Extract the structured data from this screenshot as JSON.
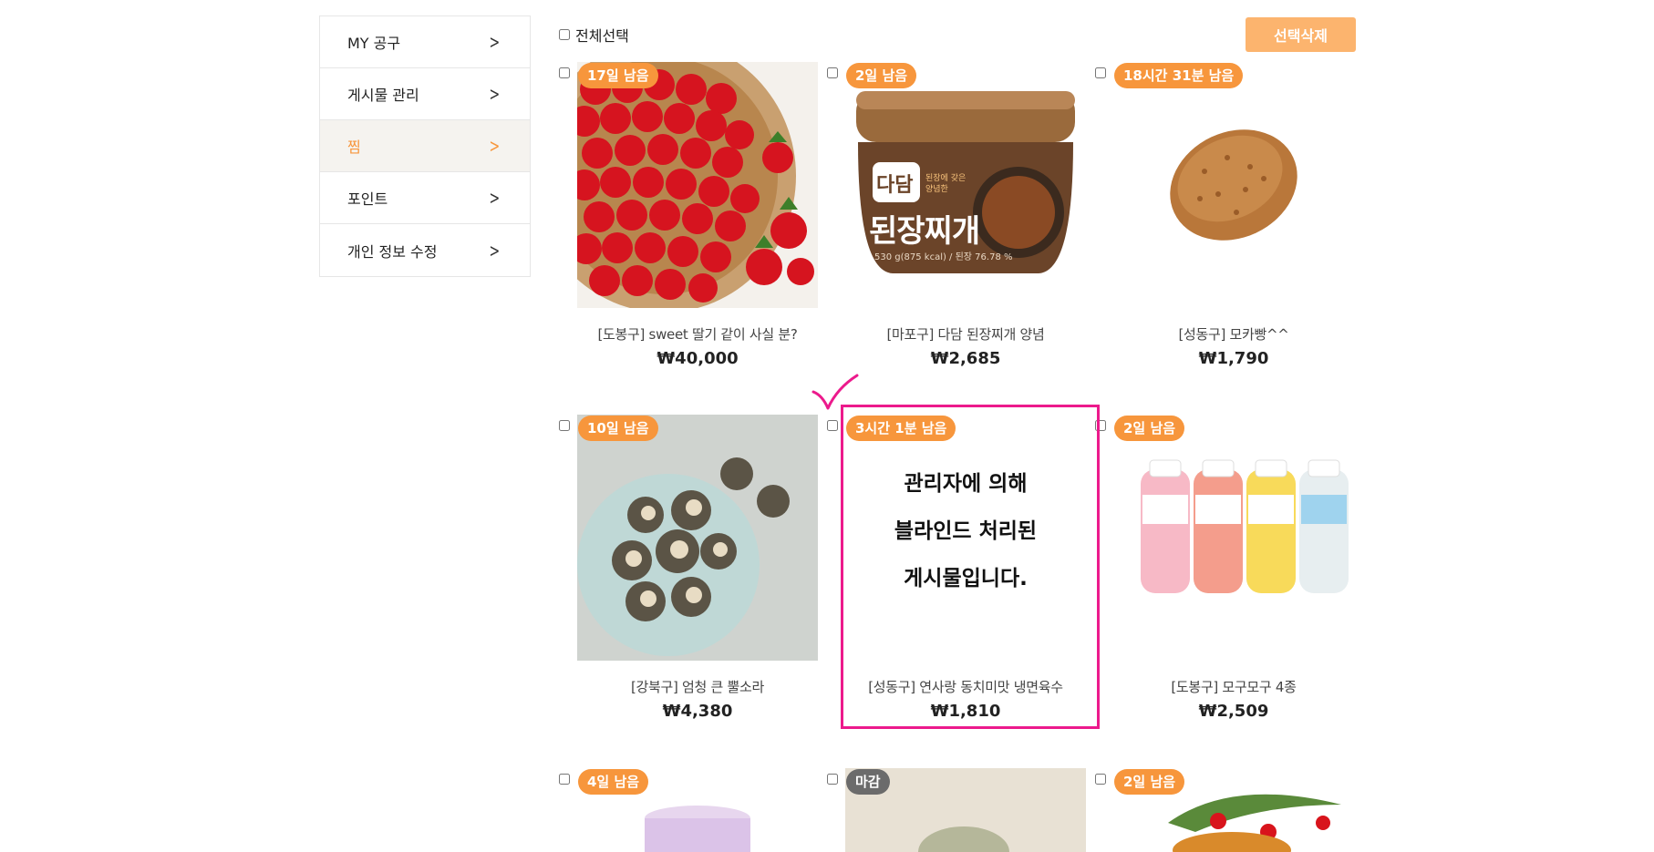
{
  "sidebar": {
    "items": [
      {
        "label": "MY 공구"
      },
      {
        "label": "게시물 관리"
      },
      {
        "label": "찜"
      },
      {
        "label": "포인트"
      },
      {
        "label": "개인 정보 수정"
      }
    ]
  },
  "toolbar": {
    "select_all_label": "전체선택",
    "delete_label": "선택삭제"
  },
  "products": [
    {
      "badge": "17일 남음",
      "title": "[도봉구] sweet 딸기 같이 사실 분?",
      "price": "₩40,000"
    },
    {
      "badge": "2일 남음",
      "title": "[마포구] 다담 된장찌개 양념",
      "price": "₩2,685",
      "jar_label": "다담",
      "jar_name": "된장찌개",
      "jar_side": "된장에 갖은 양념한",
      "jar_info": "530 g(875 kcal) / 된장 76.78 %"
    },
    {
      "badge": "18시간 31분 남음",
      "title": "[성동구] 모카빵^^",
      "price": "₩1,790"
    },
    {
      "badge": "10일 남음",
      "title": "[강북구] 엄청 큰 뿔소라",
      "price": "₩4,380"
    },
    {
      "badge": "3시간 1분 남음",
      "title": "[성동구] 연사랑 동치미맛 냉면육수",
      "price": "₩1,810",
      "blind_lines": [
        "관리자에 의해",
        "블라인드 처리된",
        "게시물입니다."
      ]
    },
    {
      "badge": "2일 남음",
      "title": "[도봉구] 모구모구 4종",
      "price": "₩2,509"
    },
    {
      "badge": "4일 남음"
    },
    {
      "badge": "마감"
    },
    {
      "badge": "2일 남음"
    }
  ],
  "colors": {
    "accent": "#f7963c",
    "button": "#fcb46e",
    "highlight": "#ec1a8c",
    "closed_badge": "#6b6b6b"
  }
}
